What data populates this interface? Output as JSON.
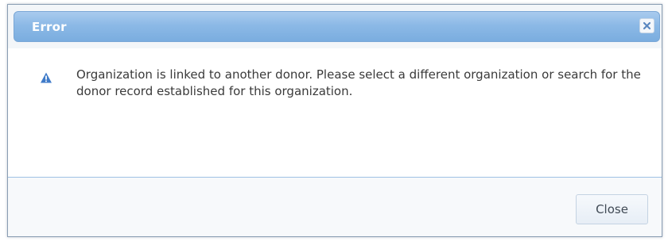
{
  "dialog": {
    "title": "Error",
    "close_icon": "close-icon",
    "warning_icon": "warning-icon",
    "message": "Organization is linked to another donor. Please select a different organization or search for the donor record established for this organization.",
    "close_button_label": "Close"
  },
  "colors": {
    "titlebar": "#8cb9e6",
    "divider": "#9ec1e4",
    "icon_blue": "#3f7bc9"
  }
}
